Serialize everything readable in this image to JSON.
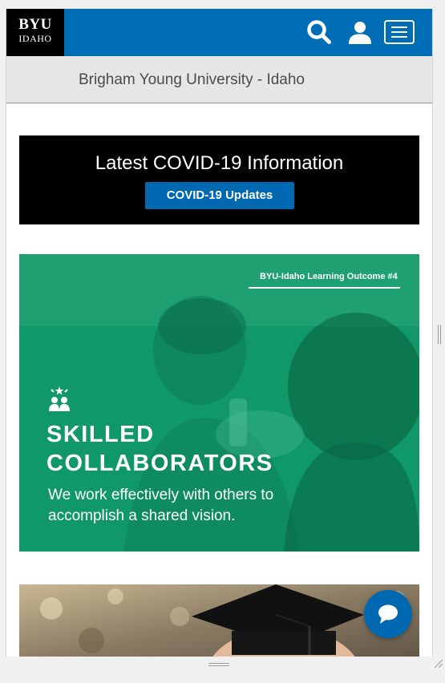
{
  "header": {
    "logo_line1": "BYU",
    "logo_line2": "IDAHO",
    "icons": [
      "search-icon",
      "user-icon",
      "menu-icon"
    ],
    "color": "#006eb6"
  },
  "subheader": {
    "title": "Brigham Young University - Idaho"
  },
  "covid_banner": {
    "title": "Latest COVID-19 Information",
    "button_label": "COVID-19 Updates",
    "button_color": "#0068b0"
  },
  "outcome_banner": {
    "outcome_label": "BYU-Idaho Learning Outcome #4",
    "title_line1": "SKILLED",
    "title_line2": "COLLABORATORS",
    "desc_line1": "We work effectively with others to",
    "desc_line2": "accomplish a shared vision.",
    "color": "#119868",
    "icon": "collaborators-icon"
  },
  "graduation_banner": {
    "image": "graduation-photo"
  },
  "chat": {
    "icon": "chat-bubble-icon",
    "color": "#0068b0"
  }
}
